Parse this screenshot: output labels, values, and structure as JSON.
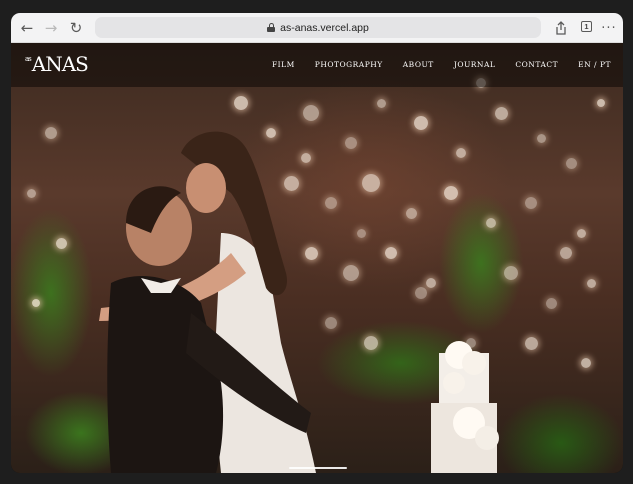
{
  "browser": {
    "url": "as-anas.vercel.app",
    "tab_count": "1",
    "icons": [
      "back-arrow-icon",
      "forward-arrow-icon",
      "reload-icon",
      "lock-icon",
      "share-icon",
      "tabs-icon",
      "more-icon"
    ]
  },
  "site": {
    "logo_prefix": "as",
    "logo_text": "ANAS",
    "nav": [
      "FILM",
      "PHOTOGRAPHY",
      "ABOUT",
      "JOURNAL",
      "CONTACT",
      "EN / PT"
    ]
  },
  "colors": {
    "toolbar": "#f3f3f4",
    "header_overlay": "rgba(0,0,0,0.45)",
    "nav_text": "#ffffff"
  }
}
